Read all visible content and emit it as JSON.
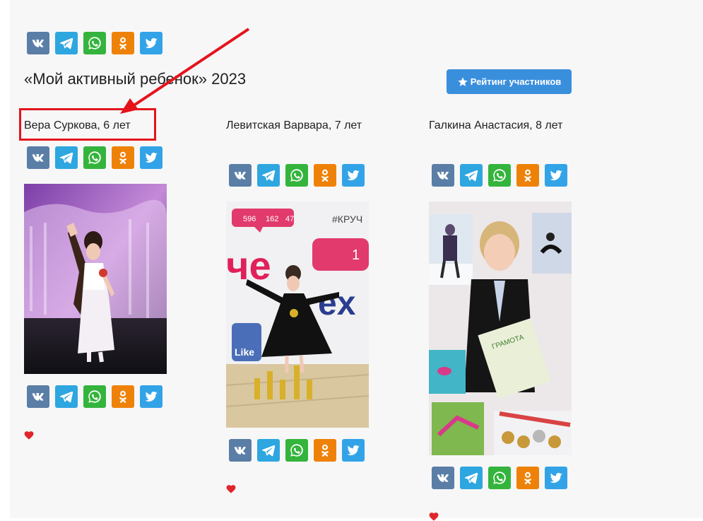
{
  "page": {
    "contest_title": "«Мой активный ребенок» 2023",
    "rating_button_label": "Рейтинг участников"
  },
  "icons": {
    "share": [
      "vk-icon",
      "telegram-icon",
      "whatsapp-icon",
      "odnoklassniki-icon",
      "twitter-icon"
    ],
    "rating": "star-icon",
    "like": "heart-icon"
  },
  "colors": {
    "vk": "#5a7ea6",
    "telegram": "#2ea6e0",
    "whatsapp": "#34b43c",
    "odnoklassniki": "#ee8208",
    "twitter": "#33a3e8",
    "rating_button": "#3a8fdd",
    "heart": "#e0262a",
    "highlight": "#e4141b"
  },
  "participants": [
    {
      "name": "Вера Суркова, 6 лет"
    },
    {
      "name": "Левитская Варвара, 7 лет"
    },
    {
      "name": "Галкина Анастасия, 8 лет"
    }
  ],
  "photo_overlay": {
    "comments": "596",
    "likes": "162",
    "followers": "47",
    "hashtag": "#КРУЧ",
    "sign_like": "Like",
    "counter": "1",
    "banner_text_1": "че",
    "banner_text_2": "ex",
    "certificate": "ГРАМОТА"
  }
}
